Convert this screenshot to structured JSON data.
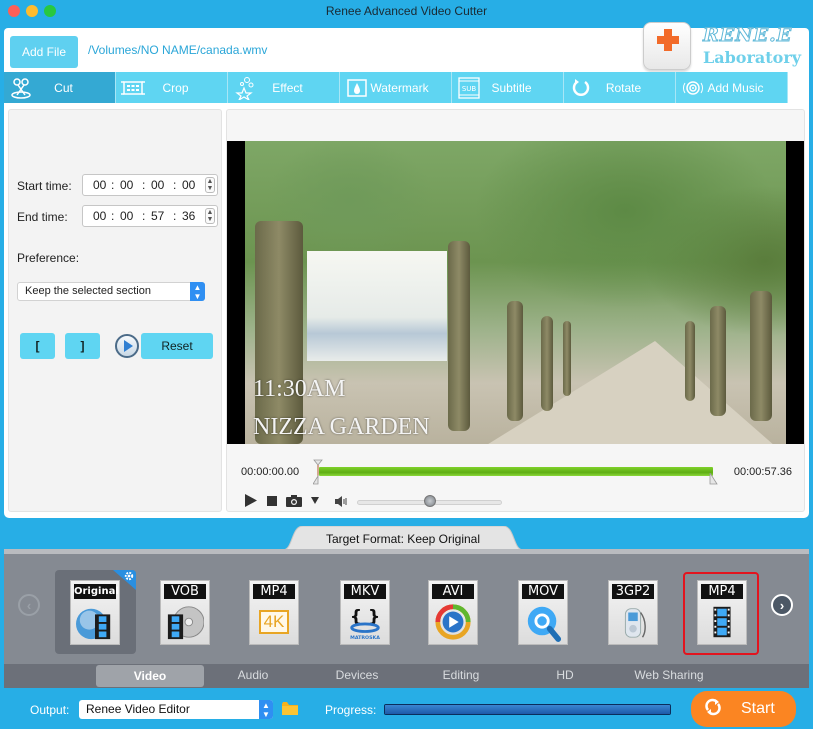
{
  "window": {
    "title": "Renee Advanced Video Cutter"
  },
  "header": {
    "add_file_label": "Add File",
    "file_path": "/Volumes/NO NAME/canada.wmv",
    "logo": {
      "brand": "RENE.E",
      "sub": "Laboratory",
      "accent": "#f26b2a"
    }
  },
  "toolbar": {
    "tabs": [
      {
        "label": "Cut",
        "icon": "scissors-icon",
        "active": true
      },
      {
        "label": "Crop",
        "icon": "crop-icon",
        "active": false
      },
      {
        "label": "Effect",
        "icon": "stars-icon",
        "active": false
      },
      {
        "label": "Watermark",
        "icon": "watermark-icon",
        "active": false
      },
      {
        "label": "Subtitle",
        "icon": "subtitle-icon",
        "active": false
      },
      {
        "label": "Rotate",
        "icon": "rotate-icon",
        "active": false
      },
      {
        "label": "Add Music",
        "icon": "music-icon",
        "active": false
      }
    ]
  },
  "cut_panel": {
    "start_label": "Start time:",
    "start_time": {
      "h": "00",
      "m": "00",
      "s": "00",
      "ms": "00"
    },
    "end_label": "End time:",
    "end_time": {
      "h": "00",
      "m": "00",
      "s": "57",
      "ms": "36"
    },
    "preference_label": "Preference:",
    "preference_value": "Keep the selected section",
    "mark_in_label": "[",
    "mark_out_label": "]",
    "reset_label": "Reset"
  },
  "player": {
    "caption_time": "11:30AM",
    "caption_place": "NIZZA GARDEN",
    "current_time": "00:00:00.00",
    "total_time": "00:00:57.36",
    "selection_start_fraction": 0.0,
    "selection_end_fraction": 1.0,
    "volume_fraction": 0.5
  },
  "format": {
    "target_label": "Target Format: Keep Original",
    "items": [
      {
        "label": "Original",
        "icon": "original-format-icon",
        "selected": true
      },
      {
        "label": "VOB",
        "icon": "dvd-icon",
        "selected": false
      },
      {
        "label": "MP4",
        "icon": "4k-icon",
        "sub": "4K",
        "selected": false
      },
      {
        "label": "MKV",
        "icon": "matroska-icon",
        "sub": "MATROSKA",
        "selected": false
      },
      {
        "label": "AVI",
        "icon": "media-player-icon",
        "selected": false
      },
      {
        "label": "MOV",
        "icon": "quicktime-icon",
        "selected": false
      },
      {
        "label": "3GP2",
        "icon": "mobile-player-icon",
        "selected": false
      },
      {
        "label": "MP4",
        "icon": "film-icon",
        "selected": false,
        "highlighted": true
      }
    ],
    "categories": [
      {
        "label": "Video",
        "active": true
      },
      {
        "label": "Audio",
        "active": false
      },
      {
        "label": "Devices",
        "active": false
      },
      {
        "label": "Editing",
        "active": false
      },
      {
        "label": "HD",
        "active": false
      },
      {
        "label": "Web Sharing",
        "active": false
      }
    ]
  },
  "bottom": {
    "output_label": "Output:",
    "output_value": "Renee Video Editor",
    "progress_label": "Progress:",
    "progress_fraction": 1.0,
    "start_label": "Start"
  },
  "colors": {
    "brand_blue": "#27aee6",
    "tab_blue": "#5fd5f2",
    "start_orange": "#fb8522",
    "timeline_green": "#6ec21e",
    "highlight_red": "#e3141e"
  }
}
